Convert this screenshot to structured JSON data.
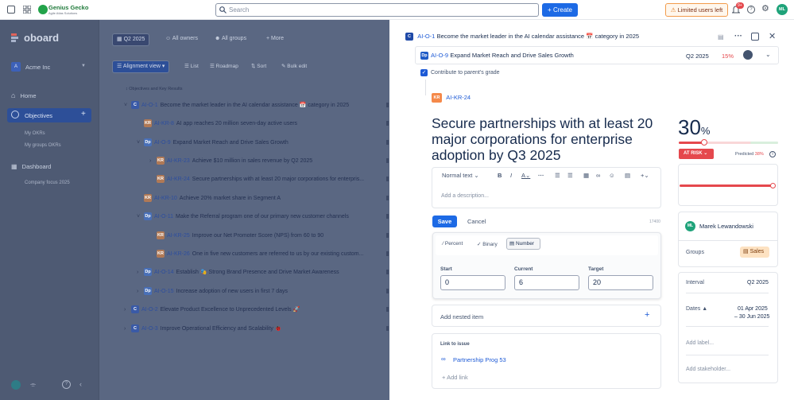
{
  "topbar": {
    "brand": "Genius Gecko",
    "brand_sub": "Agile Atlas Solutions",
    "search_placeholder": "Search",
    "create_label": "+ Create",
    "limited_label": "Limited users left",
    "notif_count": "9+",
    "avatar": "ML"
  },
  "sidebar": {
    "logo": "oboard",
    "workspace": "Acme Inc",
    "workspace_badge": "A",
    "home": "Home",
    "objectives": "Objectives",
    "my_okrs": "My OKRs",
    "my_groups_okrs": "My groups OKRs",
    "dashboard": "Dashboard",
    "company_focus": "Company focus 2025"
  },
  "filters": {
    "period": "Q2 2025",
    "owners": "All owners",
    "groups": "All groups",
    "more": "More",
    "view": "Alignment view",
    "list": "List",
    "roadmap": "Roadmap",
    "sort": "Sort",
    "bulk_edit": "Bulk edit",
    "header": "Objectives and Key Results"
  },
  "tree": [
    {
      "badge": "C",
      "id": "AI-O-1",
      "text": "Become the market leader in the AI calendar assistance 📅 category in 2025"
    },
    {
      "badge": "KR",
      "id": "AI-KR-8",
      "text": "AI app reaches 20 million seven-day active users"
    },
    {
      "badge": "Dp",
      "id": "AI-O-9",
      "text": "Expand Market Reach and Drive Sales Growth"
    },
    {
      "badge": "KR",
      "id": "AI-KR-23",
      "text": "Achieve $10 million in sales revenue by Q2 2025"
    },
    {
      "badge": "KR",
      "id": "AI-KR-24",
      "text": "Secure partnerships with at least 20 major corporations for enterpris..."
    },
    {
      "badge": "KR",
      "id": "AI-KR-10",
      "text": "Achieve 20% market share in Segment A"
    },
    {
      "badge": "Dp",
      "id": "AI-O-11",
      "text": "Make the Referral program one of our primary new customer channels"
    },
    {
      "badge": "KR",
      "id": "AI-KR-25",
      "text": "Improve our Net Promoter Score (NPS) from 60 to 90"
    },
    {
      "badge": "KR",
      "id": "AI-KR-26",
      "text": "One in five new customers are referred to us by our existing custom..."
    },
    {
      "badge": "Dp",
      "id": "AI-O-14",
      "text": "Establish 🎭 Strong Brand Presence and Drive Market Awareness"
    },
    {
      "badge": "Dp",
      "id": "AI-O-15",
      "text": "Increase adoption of new users in first 7 days"
    },
    {
      "badge": "C",
      "id": "AI-O-2",
      "text": "Elevate Product Excellence to Unprecedented Levels 🚀"
    },
    {
      "badge": "C",
      "id": "AI-O-3",
      "text": "Improve Operational Efficiency and Scalability 🐞"
    }
  ],
  "panel": {
    "parent_badge": "C",
    "parent_id": "AI-O-1",
    "parent_text": "Become the market leader in the AI calendar assistance 📅 category in 2025",
    "sub_badge": "Dp",
    "sub_id": "AI-O-9",
    "sub_text": "Expand Market Reach and Drive Sales Growth",
    "sub_period": "Q2 2025",
    "sub_pct": "15%",
    "contribute": "Contribute to parent's grade",
    "kr_badge": "KR",
    "kr_id": "AI-KR-24",
    "title": "Secure partnerships with at least 20 major corporations for enterprise adoption by Q3 2025",
    "editor_style": "Normal text",
    "description_placeholder": "Add a description...",
    "save": "Save",
    "cancel": "Cancel",
    "char_limit": "17400",
    "type_percent": "Percent",
    "type_binary": "Binary",
    "type_number": "Number",
    "start_label": "Start",
    "current_label": "Current",
    "target_label": "Target",
    "start_value": "0",
    "current_value": "6",
    "target_value": "20",
    "nested_item": "Add nested item",
    "link_to_issue": "Link to issue",
    "linked_issue": "Partnership Prog 53",
    "add_link": "Add link",
    "progress": "30",
    "progress_unit": "%",
    "status": "AT RISK",
    "predicted_label": "Predicted",
    "predicted_value": "38%",
    "owner_initials": "ML",
    "owner_name": "Marek Lewandowski",
    "groups_label": "Groups",
    "group_value": "Sales",
    "interval_label": "Interval",
    "interval_value": "Q2 2025",
    "dates_label": "Dates",
    "date_start": "01 Apr 2025",
    "date_end": "– 30 Jun 2025",
    "add_label": "Add label...",
    "add_stakeholder": "Add stakeholder...",
    "colors": {
      "accent": "#1d6ae5",
      "risk": "#e5484d",
      "predicted": "#e5484d"
    }
  }
}
